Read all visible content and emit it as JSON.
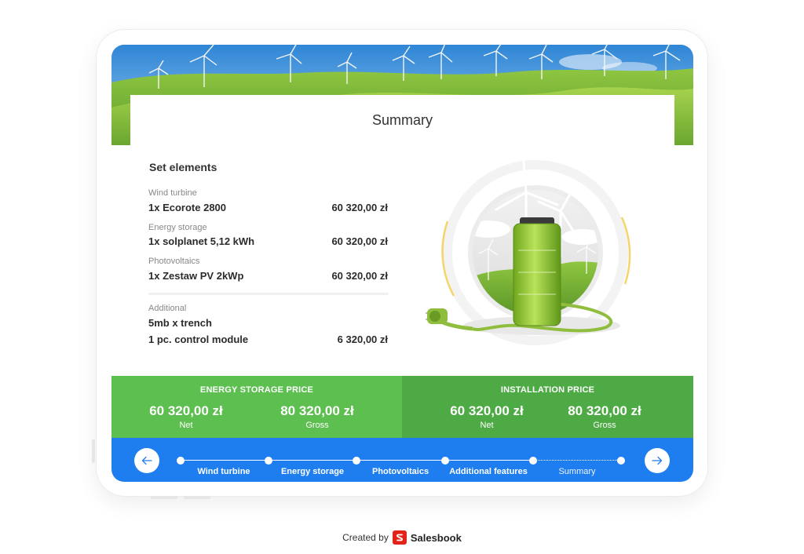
{
  "card": {
    "title": "Summary"
  },
  "set_elements": {
    "title": "Set elements",
    "items": [
      {
        "category": "Wind turbine",
        "name": "1x Ecorote 2800",
        "price": "60 320,00 zł"
      },
      {
        "category": "Energy storage",
        "name": "1x solplanet 5,12 kWh",
        "price": "60 320,00 zł"
      },
      {
        "category": "Photovoltaics",
        "name": "1x Zestaw PV 2kWp",
        "price": "60 320,00 zł"
      }
    ],
    "additional": {
      "category": "Additional",
      "lines": [
        {
          "name": "5mb x trench",
          "price": ""
        },
        {
          "name": "1 pc. control module",
          "price": "6 320,00 zł"
        }
      ]
    }
  },
  "prices": {
    "energy_storage": {
      "title": "ENERGY STORAGE PRICE",
      "net_value": "60 320,00 zł",
      "net_label": "Net",
      "gross_value": "80 320,00 zł",
      "gross_label": "Gross"
    },
    "installation": {
      "title": "INSTALLATION PRICE",
      "net_value": "60 320,00 zł",
      "net_label": "Net",
      "gross_value": "80 320,00 zł",
      "gross_label": "Gross"
    }
  },
  "navigation": {
    "steps": [
      {
        "label": "Wind turbine"
      },
      {
        "label": "Energy storage"
      },
      {
        "label": "Photovoltaics"
      },
      {
        "label": "Additional features"
      },
      {
        "label": "Summary"
      }
    ],
    "current_step": "Summary",
    "prev_icon": "arrow-left-icon",
    "next_icon": "arrow-right-icon"
  },
  "footer": {
    "created_by": "Created by",
    "brand": "Salesbook"
  },
  "colors": {
    "accent_blue": "#1e7ef0",
    "green_light": "#5cbf4f",
    "green_dark": "#4eaa45",
    "brand_red": "#e2231a"
  }
}
